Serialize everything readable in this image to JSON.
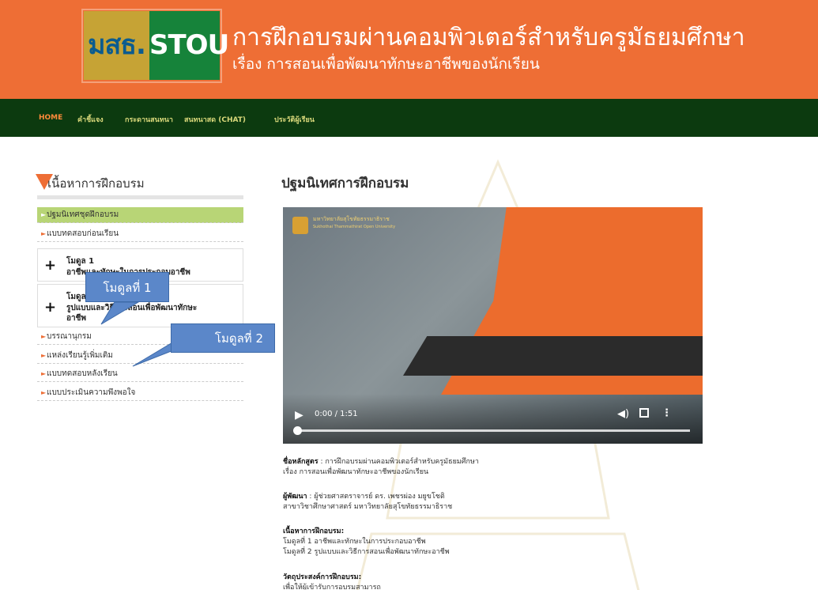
{
  "header": {
    "logo_left": "มสธ.",
    "logo_right": "STOU",
    "title": "การฝึกอบรมผ่านคอมพิวเตอร์สำหรับครูมัธยมศึกษา",
    "subtitle": "เรื่อง การสอนเพื่อพัฒนาทักษะอาชีพของนักเรียน",
    "color": "#ee6e35"
  },
  "nav": {
    "items": [
      "HOME",
      "คำชี้แจง",
      "กระดานสนทนา",
      "สนทนาสด (CHAT)",
      "ประวัติผู้เรียน"
    ],
    "active": "HOME",
    "color": "#0c3a0f"
  },
  "sidebar": {
    "heading": "เนื้อหาการฝึกอบรม",
    "links_top": [
      "ปฐมนิเทศชุดฝึกอบรม",
      "แบบทดสอบก่อนเรียน"
    ],
    "modules": [
      {
        "title": "โมดูล 1",
        "subtitle": "อาชีพและทักษะในการประกอบอาชีพ"
      },
      {
        "title": "โมดูล 2",
        "subtitle_1": "รูปแบบและวิธีการสอนเพื่อพัฒนาทักษะ",
        "subtitle_2": "อาชีพ"
      }
    ],
    "links_bottom": [
      "บรรณานุกรม",
      "แหล่งเรียนรู้เพิ่มเติม",
      "แบบทดสอบหลังเรียน",
      "แบบประเมินความพึงพอใจ"
    ],
    "active": "ปฐมนิเทศชุดฝึกอบรม"
  },
  "callouts": {
    "one": "โมดูลที่ 1",
    "two": "โมดูลที่ 2",
    "color": "#5b87c9"
  },
  "main": {
    "title": "ปฐมนิเทศการฝึกอบรม",
    "video": {
      "university_th": "มหาวิทยาลัยสุโขทัยธรรมาธิราช",
      "university_en": "Sukhothai Thammathirat Open University",
      "time": "0:00 / 1:51",
      "progress": 0
    },
    "info": {
      "course_label": "ชื่อหลักสูตร",
      "course_value": " : การฝึกอบรมผ่านคอมพิวเตอร์สำหรับครูมัธยมศึกษา",
      "course_line2": "เรื่อง การสอนเพื่อพัฒนาทักษะอาชีพของนักเรียน",
      "dev_label": "ผู้พัฒนา",
      "dev_value": " : ผู้ช่วยศาสตราจารย์ ดร. เพชรผ่อง มยูขโชติ",
      "dev_line2": "สาขาวิชาศึกษาศาสตร์ มหาวิทยาลัยสุโขทัยธรรมาธิราช",
      "content_label": "เนื้อหาการฝึกอบรม:",
      "content_1": "โมดูลที่ 1 อาชีพและทักษะในการประกอบอาชีพ",
      "content_2": "โมดูลที่ 2 รูปแบบและวิธีการสอนเพื่อพัฒนาทักษะอาชีพ",
      "objective_label": "วัตถุประสงค์การฝึกอบรม:",
      "objective_1": "เพื่อให้ผู้เข้ารับการอบรมสามารถ"
    }
  }
}
